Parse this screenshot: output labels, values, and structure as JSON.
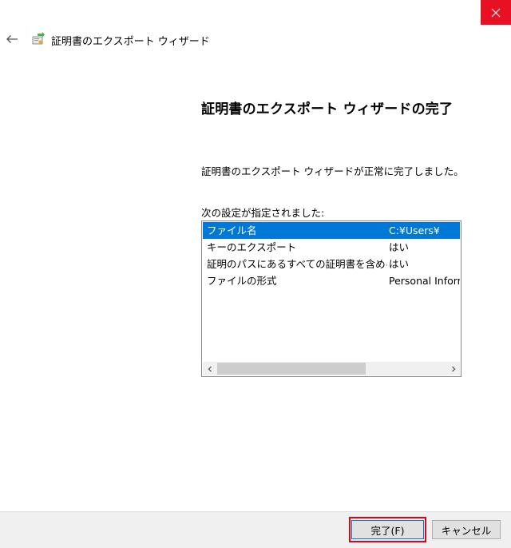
{
  "window": {
    "title": "証明書のエクスポート ウィザード",
    "close_icon": "close-icon",
    "back_icon": "back-arrow-icon",
    "wizard_icon": "certificate-icon",
    "close_color": "#e81123"
  },
  "content": {
    "heading": "証明書のエクスポート ウィザードの完了",
    "message": "証明書のエクスポート ウィザードが正常に完了しました。",
    "settings_label": "次の設定が指定されました:"
  },
  "settings": {
    "rows": [
      {
        "name": "ファイル名",
        "value": "C:¥Users¥",
        "selected": true
      },
      {
        "name": "キーのエクスポート",
        "value": "はい",
        "selected": false
      },
      {
        "name": "証明のパスにあるすべての証明書を含める",
        "value": "はい",
        "selected": false
      },
      {
        "name": "ファイルの形式",
        "value": "Personal Inform",
        "selected": false
      }
    ],
    "selection_color": "#0078d7"
  },
  "buttons": {
    "finish": "完了(F)",
    "cancel": "キャンセル",
    "highlight_color": "#e60012"
  }
}
